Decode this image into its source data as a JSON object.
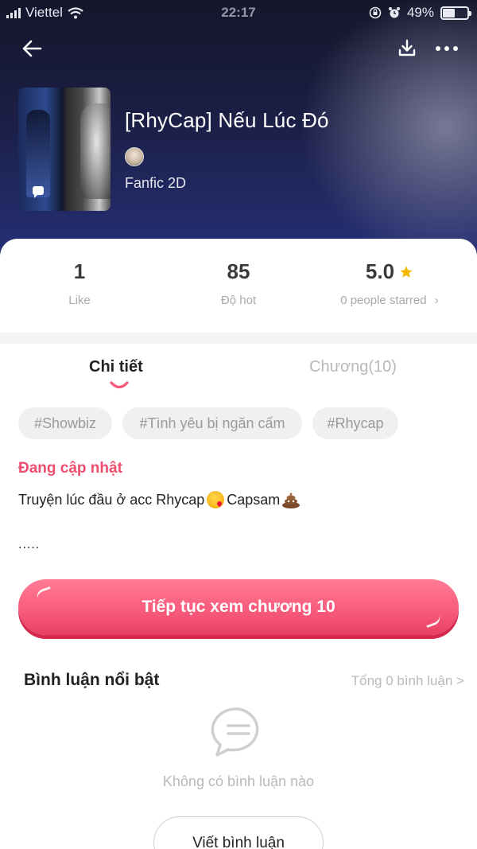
{
  "status_bar": {
    "carrier": "Viettel",
    "time": "22:17",
    "battery": "49%",
    "battery_level": 0.49
  },
  "header": {
    "back_icon": "arrow-left-icon",
    "download_icon": "download-icon",
    "more_icon": "more-horizontal-icon",
    "title": "[RhyCap] Nếu Lúc Đó",
    "genre": "Fanfic 2D"
  },
  "stats": {
    "like_value": "1",
    "like_label": "Like",
    "hot_value": "85",
    "hot_label": "Độ hot",
    "rating_value": "5.0",
    "rating_label": "0 people starred",
    "rating_chevron": "›"
  },
  "tabs": {
    "detail": "Chi tiết",
    "chapters": "Chương(10)"
  },
  "tags": [
    "#Showbiz",
    "#Tình yêu bị ngăn cấm",
    "#Rhycap"
  ],
  "story": {
    "status": "Đang cập nhật",
    "desc_part1": "Truyện lúc đầu ở acc Rhycap",
    "desc_part2": "Capsam",
    "ellipsis": "....."
  },
  "continue_button": "Tiếp tục xem chương 10",
  "comments": {
    "title": "Bình luận nổi bật",
    "total": "Tổng 0 bình luận >",
    "empty": "Không có bình luận nào",
    "write": "Viết bình luận"
  },
  "colors": {
    "accent": "#f7597a",
    "status_pink": "#ee4e6e",
    "star": "#f5b800",
    "muted": "#b9b9b9"
  }
}
